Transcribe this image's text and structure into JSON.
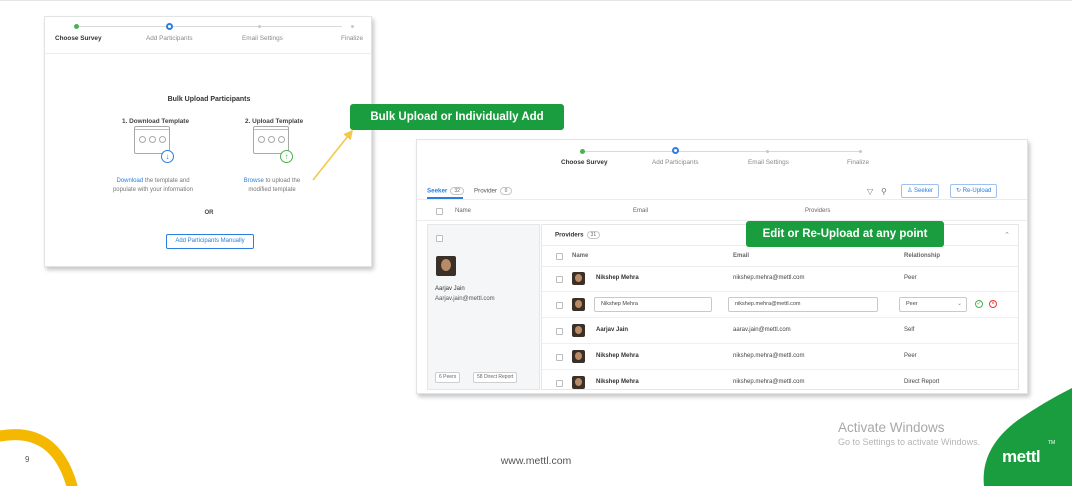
{
  "stepper": {
    "steps": [
      "Choose Survey",
      "Add Participants",
      "Email Settings",
      "Finalize"
    ]
  },
  "bulk_upload": {
    "title": "Bulk Upload Participants",
    "download_heading": "1. Download Template",
    "upload_heading": "2. Upload Template",
    "download_link": "Download",
    "download_text_1": "the template and",
    "download_text_2": "populate with your information",
    "browse_link": "Browse",
    "browse_text_1": "to upload the",
    "browse_text_2": "modified template",
    "or_label": "OR",
    "add_manually_button": "Add Participants Manually"
  },
  "callouts": {
    "bulk_upload": "Bulk Upload or Individually Add",
    "edit_reupload": "Edit or Re-Upload at any point"
  },
  "participants": {
    "tabs": [
      {
        "label": "Seeker",
        "count": "32"
      },
      {
        "label": "Provider",
        "count": "0"
      }
    ],
    "seeker_button": "Seeker",
    "reupload_button": "Re-Upload",
    "columns": {
      "name": "Name",
      "email": "Email",
      "providers": "Providers"
    },
    "seeker": {
      "name": "Aarjav Jain",
      "email": "Aarjav.jain@mettl.com",
      "peers_badge": "6 Peers",
      "direct_report_badge": "58 Direct Report"
    },
    "providers": {
      "title": "Providers",
      "count": "31",
      "columns": {
        "name": "Name",
        "email": "Email",
        "relationship": "Relationship"
      },
      "rows": [
        {
          "name": "Nikshep Mehra",
          "email": "nikshep.mehra@mettl.com",
          "relationship": "Peer"
        },
        {
          "name": "Nikshep Mehra",
          "email": "nikshep.mehra@mettl.com",
          "relationship": "Peer"
        },
        {
          "name": "Aarjav Jain",
          "email": "aarav.jain@mettl.com",
          "relationship": "Self"
        },
        {
          "name": "Nikshep Mehra",
          "email": "nikshep.mehra@mettl.com",
          "relationship": "Peer"
        },
        {
          "name": "Nikshep Mehra",
          "email": "nikshep.mehra@mettl.com",
          "relationship": "Direct Report"
        }
      ]
    }
  },
  "footer": {
    "page_number": "9",
    "url": "www.mettl.com",
    "windows_title": "Activate Windows",
    "windows_sub": "Go to Settings to activate Windows.",
    "logo": "mettl",
    "logo_tm": "TM"
  },
  "colors": {
    "brand_green": "#1a9d3e",
    "accent_blue": "#2b7de0",
    "arrow_yellow": "#f2c94c",
    "arc_yellow": "#f5b800"
  }
}
